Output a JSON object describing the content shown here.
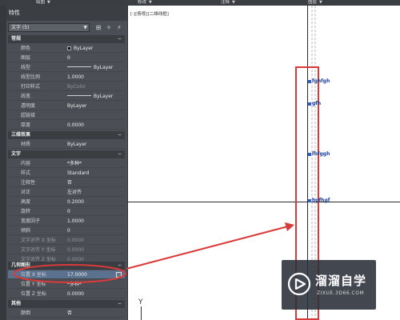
{
  "ribbon": {
    "items": [
      {
        "label": "绘图",
        "caret": "▼"
      },
      {
        "label": "修改",
        "caret": "▼"
      },
      {
        "label": "注释",
        "caret": "▼"
      },
      {
        "label": "图层",
        "caret": "▼"
      }
    ]
  },
  "palette": {
    "title": "特性",
    "selector": {
      "value": "文字 (5)",
      "dropdown": "▼"
    },
    "sections": {
      "general": {
        "label": "常规",
        "toggle": "−"
      },
      "3d": {
        "label": "三维效果",
        "toggle": "−"
      },
      "text": {
        "label": "文字",
        "toggle": "−"
      },
      "geometry": {
        "label": "几何图形",
        "toggle": "−"
      },
      "misc": {
        "label": "其他",
        "toggle": "−"
      }
    },
    "general_rows": [
      {
        "name": "颜色",
        "value": "ByLayer"
      },
      {
        "name": "图层",
        "value": "0"
      },
      {
        "name": "线型",
        "value": "ByLayer"
      },
      {
        "name": "线型比例",
        "value": "1.0000"
      },
      {
        "name": "打印样式",
        "value": "ByColor"
      },
      {
        "name": "线宽",
        "value": "ByLayer"
      },
      {
        "name": "透明度",
        "value": "ByLayer"
      },
      {
        "name": "超链接",
        "value": ""
      },
      {
        "name": "厚度",
        "value": "0.0000"
      }
    ],
    "threed_rows": [
      {
        "name": "材质",
        "value": "ByLayer"
      }
    ],
    "text_rows": [
      {
        "name": "内容",
        "value": "*多种*"
      },
      {
        "name": "样式",
        "value": "Standard"
      },
      {
        "name": "注释性",
        "value": "否"
      },
      {
        "name": "对正",
        "value": "左对齐"
      },
      {
        "name": "高度",
        "value": "0.2000"
      },
      {
        "name": "旋转",
        "value": "0"
      },
      {
        "name": "宽度因子",
        "value": "1.0000"
      },
      {
        "name": "倾斜",
        "value": "0"
      },
      {
        "name": "文字对齐 X 坐标",
        "value": "0.0000"
      },
      {
        "name": "文字对齐 Y 坐标",
        "value": "0.0000"
      },
      {
        "name": "文字对齐 Z 坐标",
        "value": "0.0000"
      }
    ],
    "geometry_rows": [
      {
        "name": "位置 X 坐标",
        "value": "17.0000"
      },
      {
        "name": "位置 Y 坐标",
        "value": "*多种*"
      },
      {
        "name": "位置 Z 坐标",
        "value": "0.0000"
      }
    ],
    "misc_rows": [
      {
        "name": "颠倒",
        "value": "否"
      }
    ]
  },
  "canvas": {
    "view_label": "[-][俯视][二维线框]",
    "text_objects": [
      "fghfgh",
      "gfh",
      "fhfggh",
      "hgfhgf"
    ],
    "axis_label": "Y"
  },
  "watermark": {
    "text": "溜溜自学",
    "sub": "ZIXUE.3D66.COM"
  },
  "colors": {
    "annotation_red": "#d93a3a",
    "palette_bg": "#4b4f55",
    "highlight": "#5a7290",
    "text_objects": "#1a3f9c"
  }
}
